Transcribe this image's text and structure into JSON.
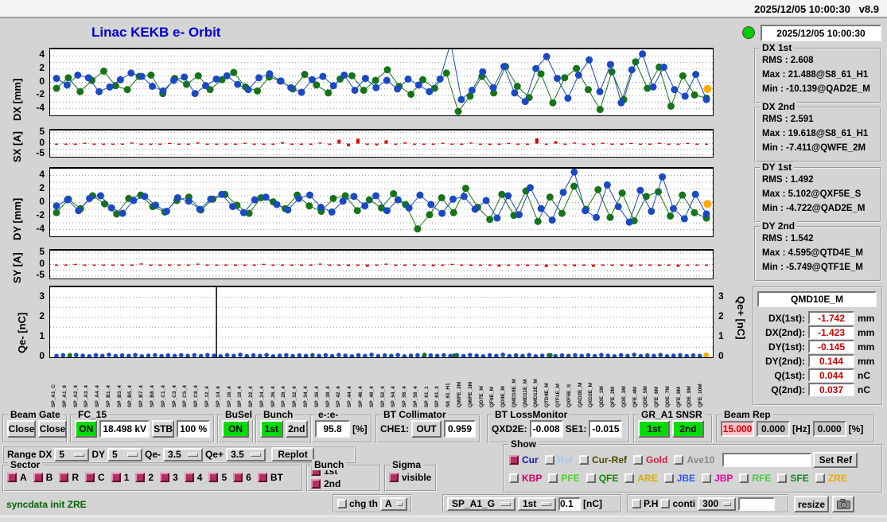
{
  "menubar": {
    "clock": "2025/12/05 10:00:30",
    "version": "v8.9"
  },
  "header": {
    "title": "Linac KEKB e- Orbit",
    "status_time": "2025/12/05 10:00:30"
  },
  "stats": [
    {
      "title": "DX 1st",
      "lines": [
        "RMS :  2.608",
        "Max :  21.488@S8_61_H1",
        "Min :  -10.139@QAD2E_M"
      ]
    },
    {
      "title": "DX 2nd",
      "lines": [
        "RMS :  2.591",
        "Max :  19.618@S8_61_H1",
        "Min :  -7.411@QWFE_2M"
      ]
    },
    {
      "title": "DY 1st",
      "lines": [
        "RMS :  1.492",
        "Max :  5.102@QXF5E_S",
        "Min :  -4.722@QAD2E_M"
      ]
    },
    {
      "title": "DY 2nd",
      "lines": [
        "RMS :  1.542",
        "Max :  4.595@QTD4E_M",
        "Min :  -5.749@QTF1E_M"
      ]
    }
  ],
  "monitor": {
    "name": "QMD10E_M",
    "rows": [
      {
        "label": "DX(1st):",
        "value": "-1.742",
        "unit": "mm"
      },
      {
        "label": "DX(2nd):",
        "value": "-1.423",
        "unit": "mm"
      },
      {
        "label": "DY(1st):",
        "value": "-0.145",
        "unit": "mm"
      },
      {
        "label": "DY(2nd):",
        "value": "0.144",
        "unit": "mm"
      },
      {
        "label": "Q(1st):",
        "value": "0.044",
        "unit": "nC"
      },
      {
        "label": "Q(2nd):",
        "value": "0.037",
        "unit": "nC"
      }
    ]
  },
  "axes": {
    "dx": "DX [mm]",
    "sx": "SX [A]",
    "dy": "DY [mm]",
    "sy": "SY [A]",
    "qem": "Qe- [nC]",
    "qep": "Qe+ [nC]"
  },
  "controls": {
    "beam_gate": {
      "legend": "Beam Gate",
      "btn1": "Close",
      "btn2": "Close"
    },
    "fc15": {
      "legend": "FC_15",
      "on": "ON",
      "kv": "18.498 kV",
      "stb": "STB",
      "pct": "100 %"
    },
    "busel": {
      "legend": "BuSel",
      "on": "ON"
    },
    "bunch": {
      "legend": "Bunch",
      "b1": "1st",
      "b2": "2nd"
    },
    "ee": {
      "legend": "e-:e-",
      "value": "95.8",
      "unit": "[%]"
    },
    "bt_coll": {
      "legend": "BT Collimator",
      "che1": "CHE1:",
      "out": "OUT",
      "value": "0.959"
    },
    "bt_loss": {
      "legend": "BT LossMonitor",
      "qxd2e_label": "QXD2E:",
      "qxd2e": "-0.008",
      "se1_label": "SE1:",
      "se1": "-0.015"
    },
    "gr_snsr": {
      "legend": "GR_A1 SNSR",
      "b1": "1st",
      "b2": "2nd"
    },
    "beam_rep": {
      "legend": "Beam Rep",
      "v1": "15.000",
      "v2": "0.000",
      "hz": "[Hz]",
      "v3": "0.000",
      "pct": "[%]"
    },
    "range": {
      "label": "Range",
      "dx_label": "DX",
      "dx": "5",
      "dy_label": "DY",
      "dy": "5",
      "qem_label": "Qe-",
      "qem": "3.5",
      "qep_label": "Qe+",
      "qep": "3.5",
      "replot": "Replot"
    },
    "sector": {
      "legend": "Sector",
      "items": [
        "A",
        "B",
        "R",
        "C",
        "1",
        "2",
        "3",
        "4",
        "5",
        "6",
        "BT"
      ]
    },
    "bunch2": {
      "legend": "Bunch",
      "items": [
        "1st",
        "2nd"
      ]
    },
    "sigma": {
      "legend": "Sigma",
      "items": [
        "visible"
      ]
    },
    "show": {
      "legend": "Show",
      "row1": [
        {
          "label": "Cur",
          "color": "#1111cc",
          "checked": true
        },
        {
          "label": "Ref",
          "color": "#a8c8f0",
          "checked": false
        },
        {
          "label": "Cur-Ref",
          "color": "#4a4a00",
          "checked": false
        },
        {
          "label": "Gold",
          "color": "#cc2244",
          "checked": false
        },
        {
          "label": "Ave10",
          "color": "#888888",
          "checked": false
        }
      ],
      "ref_input": "",
      "set_ref": "Set Ref",
      "row2": [
        {
          "label": "KBP",
          "color": "#cc0066",
          "checked": false
        },
        {
          "label": "PFE",
          "color": "#55cc33",
          "checked": false
        },
        {
          "label": "QFE",
          "color": "#118800",
          "checked": false
        },
        {
          "label": "ARE",
          "color": "#ddaa00",
          "checked": false
        },
        {
          "label": "JBE",
          "color": "#3355ee",
          "checked": false
        },
        {
          "label": "JBP",
          "color": "#ee0099",
          "checked": false
        },
        {
          "label": "RFE",
          "color": "#44cc44",
          "checked": false
        },
        {
          "label": "SFE",
          "color": "#118822",
          "checked": false
        },
        {
          "label": "ZRE",
          "color": "#eeaa00",
          "checked": false
        }
      ]
    },
    "statusbar": {
      "message": "syncdata init ZRE",
      "chg_th": "chg th",
      "th_sel": "A",
      "sp_sel": "SP_A1_G",
      "bunch_sel": "1st",
      "th_val": "0.1",
      "th_unit": "[nC]",
      "ph": "P.H",
      "conti": "conti",
      "interval": "300",
      "blank": "",
      "resize": "resize"
    }
  },
  "colors": {
    "series_blue": "#1b49c4",
    "series_green": "#177317",
    "series_red": "#dd0000",
    "series_orange": "#ffaa00",
    "on_green": "#00dd00",
    "check_maroon": "#b03060"
  },
  "xlabels": [
    "SP_A1_C",
    "SP_A1_9",
    "SP_A2_4",
    "SP_A3_4",
    "SP_A4_4",
    "SP_B1_4",
    "SP_B3_4",
    "SP_B5_4",
    "SP_B7_4",
    "SP_B8_4",
    "SP_C1_4",
    "SP_C3_4",
    "SP_C5_4",
    "SP_C8_4",
    "SP_12_4",
    "SP_14_4",
    "SP_16_4",
    "SP_18_4",
    "SP_22_4",
    "SP_24_4",
    "SP_26_4",
    "SP_28_4",
    "SP_32_4",
    "SP_34_4",
    "SP_36_4",
    "SP_38_4",
    "SP_42_4",
    "SP_44_4",
    "SP_46_4",
    "SP_48_4",
    "SP_52_4",
    "SP_54_4",
    "SP_56_4",
    "SP_58_4",
    "SP_61_1",
    "SP_61_3",
    "S8_61_H1",
    "QWFE_2M",
    "QWFE_3M",
    "QD7E_M",
    "QF8E_M",
    "QD9E_M",
    "QMD10E_M",
    "QMD11E_M",
    "QMD12E_M",
    "QTD4E_M",
    "QTF1E_M",
    "QXF5E_S",
    "QAD2E_M",
    "QXD2E_M",
    "QDE_1M",
    "QFE_2M",
    "QDE_3M",
    "QFE_4M",
    "QDE_5M",
    "QFE_6M",
    "QDE_7M",
    "QFE_8M",
    "QDE_9M",
    "QFE_10M"
  ],
  "chart_data": [
    {
      "id": "dx",
      "type": "scatter",
      "ylabel": "DX [mm]",
      "ylim": [
        -5,
        5
      ],
      "grid": [
        -4,
        -3,
        -2,
        -1,
        0,
        1,
        2,
        3,
        4
      ],
      "yticks": [
        {
          "v": 4,
          "t": "4"
        },
        {
          "v": 2,
          "t": "2"
        },
        {
          "v": 0,
          "t": "0"
        },
        {
          "v": -2,
          "t": "-2"
        },
        {
          "v": -4,
          "t": "-4"
        }
      ],
      "series": [
        {
          "name": "2nd",
          "type": "line-dots",
          "color": "#177317",
          "r": 4.5,
          "values": [
            -0.9,
            0.7,
            -1.4,
            0.3,
            1.7,
            -0.5,
            -1.1,
            0.9,
            1.1,
            -1.7,
            0.6,
            -0.3,
            1.0,
            -1.1,
            0.4,
            1.5,
            -0.7,
            -1.3,
            0.8,
            0.2,
            -1.0,
            1.2,
            -0.4,
            -1.6,
            0.5,
            1.0,
            -1.2,
            0.3,
            1.9,
            -0.6,
            -1.8,
            0.4,
            -0.9,
            1.4,
            -4.4,
            -2.1,
            0.9,
            -1.6,
            2.4,
            -0.6,
            -2.3,
            1.3,
            -3.1,
            0.7,
            2.1,
            -1.1,
            -4.1,
            1.6,
            -2.6,
            3.1,
            -0.9,
            2.3,
            -3.6,
            1.0,
            -1.9,
            -2.4
          ]
        },
        {
          "name": "1st",
          "type": "line-dots",
          "color": "#1b49c4",
          "r": 4.5,
          "values": [
            0.6,
            -0.4,
            1.1,
            0.7,
            -1.4,
            -0.7,
            0.4,
            1.4,
            0.9,
            -0.6,
            -1.3,
            0.3,
            0.8,
            -1.7,
            -0.5,
            0.5,
            1.0,
            -0.3,
            -1.1,
            0.7,
            1.3,
            0.2,
            -0.8,
            -1.5,
            0.4,
            0.9,
            -0.5,
            1.1,
            -1.2,
            0.6,
            -0.8,
            0.3,
            -1.0,
            0.5,
            -0.4,
            -1.4,
            0.5,
            6.0,
            -2.6,
            -1.2,
            1.6,
            -0.8,
            2.4,
            -1.6,
            -2.9,
            2.1,
            3.9,
            0.6,
            -2.4,
            1.1,
            3.4,
            -1.4,
            2.7,
            -3.1,
            1.9,
            4.3,
            -0.7,
            2.3,
            -1.1,
            -2.1,
            1.2,
            -2.6
          ]
        },
        {
          "name": "marker",
          "type": "dots",
          "color": "#ffaa00",
          "r": 5,
          "points": [
            [
              0.992,
              -1.0
            ]
          ]
        }
      ]
    },
    {
      "id": "sx",
      "type": "bar",
      "ylabel": "SX [A]",
      "ylim": [
        -6,
        6
      ],
      "grid": [
        -5,
        -2.5,
        0,
        2.5,
        5
      ],
      "yticks": [
        {
          "v": 5,
          "t": "5"
        },
        {
          "v": 0,
          "t": "0"
        },
        {
          "v": -5,
          "t": "-5"
        }
      ],
      "series": [
        {
          "name": "SX",
          "type": "bars",
          "color": "#dd0000",
          "values": [
            0,
            0,
            0,
            0.4,
            0,
            -0.3,
            0,
            0,
            0.5,
            0,
            0,
            -0.4,
            0.3,
            0,
            0,
            0.6,
            0,
            0,
            -0.5,
            0,
            0.4,
            0,
            0,
            0,
            0.7,
            0,
            -0.4,
            0,
            0.5,
            0,
            1.8,
            -1.2,
            2.2,
            0,
            -0.8,
            1.5,
            0,
            0.6,
            0,
            -0.5,
            0,
            0.4,
            0,
            0,
            0.5,
            0,
            -0.6,
            0,
            0.3,
            0,
            0,
            2.4,
            0,
            1.1,
            0,
            0.5,
            0,
            0,
            0.4,
            0,
            0,
            0.3,
            0,
            0,
            0.4,
            0,
            0,
            0.3,
            0,
            0
          ]
        }
      ]
    },
    {
      "id": "dy",
      "type": "scatter",
      "ylabel": "DY [mm]",
      "ylim": [
        -5,
        5
      ],
      "grid": [
        -4,
        -3,
        -2,
        -1,
        0,
        1,
        2,
        3,
        4
      ],
      "yticks": [
        {
          "v": 4,
          "t": "4"
        },
        {
          "v": 2,
          "t": "2"
        },
        {
          "v": 0,
          "t": "0"
        },
        {
          "v": -2,
          "t": "-2"
        },
        {
          "v": -4,
          "t": "-4"
        }
      ],
      "series": [
        {
          "name": "2nd",
          "type": "line-dots",
          "color": "#177317",
          "r": 4.5,
          "values": [
            -1.5,
            0.5,
            -0.9,
            1.0,
            -0.2,
            -1.7,
            0.6,
            1.1,
            -0.6,
            -1.4,
            0.3,
            0.8,
            -1.1,
            0.5,
            1.2,
            -0.4,
            -1.6,
            0.7,
            0.1,
            -0.9,
            1.1,
            -0.5,
            -1.3,
            0.6,
            1.0,
            -1.2,
            0.4,
            -0.8,
            1.3,
            -0.3,
            -3.9,
            -1.8,
            0.7,
            -1.5,
            2.1,
            -0.7,
            -2.5,
            1.2,
            -1.9,
            1.7,
            -2.8,
            0.8,
            -1.6,
            2.4,
            -1.0,
            1.9,
            -2.2,
            1.4,
            -2.7,
            0.9,
            1.6,
            -2.0,
            1.1,
            -1.5,
            -2.3
          ]
        },
        {
          "name": "1st",
          "type": "line-dots",
          "color": "#1b49c4",
          "r": 4.5,
          "values": [
            -0.5,
            0.4,
            -1.2,
            0.6,
            1.0,
            -0.8,
            -1.6,
            0.3,
            0.9,
            -0.4,
            -1.3,
            0.7,
            0.2,
            -1.0,
            0.5,
            1.2,
            -0.6,
            -1.5,
            0.4,
            0.8,
            -0.3,
            -1.1,
            0.6,
            1.1,
            -0.7,
            -1.4,
            0.2,
            0.9,
            -0.5,
            1.0,
            -1.2,
            0.4,
            -0.8,
            1.1,
            -0.3,
            -1.6,
            0.5,
            0.9,
            -1.0,
            0.3,
            -2.3,
            1.0,
            -1.8,
            2.2,
            -0.9,
            -2.6,
            1.5,
            4.5,
            -1.2,
            -2.2,
            2.6,
            -0.6,
            -2.9,
            1.8,
            -1.3,
            3.8,
            -0.9,
            -2.4,
            1.2,
            -1.7
          ]
        },
        {
          "name": "marker",
          "type": "dots",
          "color": "#ffaa00",
          "r": 5,
          "points": [
            [
              0.992,
              -0.2
            ]
          ]
        }
      ]
    },
    {
      "id": "sy",
      "type": "bar",
      "ylabel": "SY [A]",
      "ylim": [
        -6,
        6
      ],
      "grid": [
        -5,
        -2.5,
        0,
        2.5,
        5
      ],
      "yticks": [
        {
          "v": 5,
          "t": "5"
        },
        {
          "v": 0,
          "t": "0"
        },
        {
          "v": -5,
          "t": "-5"
        }
      ],
      "series": [
        {
          "name": "SY",
          "type": "bars",
          "color": "#dd0000",
          "values": [
            0,
            0,
            0.3,
            0,
            0,
            -0.4,
            0,
            0,
            0,
            0.5,
            0,
            0,
            -0.3,
            0,
            0,
            0.4,
            0,
            0,
            0,
            -0.5,
            0,
            0,
            0.3,
            0,
            0,
            -0.4,
            0,
            0,
            0.4,
            0,
            0,
            -0.6,
            0,
            -0.9,
            0,
            0.4,
            0,
            -0.5,
            0,
            0,
            -0.7,
            0,
            0.3,
            0,
            -0.5,
            0,
            0,
            -0.8,
            0,
            0,
            -0.6,
            0,
            -1.0,
            0,
            0,
            -0.7,
            0,
            -0.9,
            0,
            -0.5,
            0,
            -0.8,
            0,
            0,
            -0.6,
            0,
            -0.9,
            -0.4,
            0,
            0
          ]
        }
      ]
    },
    {
      "id": "qe",
      "type": "scatter",
      "ylabel": "Qe- [nC]",
      "ylabel_right": "Qe+ [nC]",
      "ylim": [
        0,
        3.5
      ],
      "grid": [
        0.5,
        1,
        1.5,
        2,
        2.5,
        3
      ],
      "yticks": [
        {
          "v": 3,
          "t": "3"
        },
        {
          "v": 2,
          "t": "2"
        },
        {
          "v": 1,
          "t": "1"
        },
        {
          "v": 0,
          "t": "0"
        }
      ],
      "yticks_right": [
        {
          "v": 3,
          "t": "3"
        },
        {
          "v": 2,
          "t": "2"
        },
        {
          "v": 1,
          "t": "1"
        },
        {
          "v": 0,
          "t": "0"
        }
      ],
      "series": [
        {
          "name": "spike",
          "type": "vline",
          "color": "#000000",
          "x": 0.251
        },
        {
          "name": "Qe-",
          "type": "dots-even",
          "color": "#1b49c4",
          "r": 2.8,
          "values": [
            0.07,
            0.1,
            0.06,
            0.11,
            0.08,
            0.05,
            0.1,
            0.07,
            0.12,
            0.06,
            0.09,
            0.07,
            0.11,
            0.05,
            0.08,
            0.1,
            0.06,
            0.09,
            0.07,
            0.1,
            0.07,
            0.1,
            0.06,
            0.11,
            0.08,
            0.05,
            0.1,
            0.07,
            0.12,
            0.06,
            0.09,
            0.07,
            0.11,
            0.05,
            0.08,
            0.1,
            0.06,
            0.09,
            0.07,
            0.1,
            0.07,
            0.1,
            0.06,
            0.11,
            0.08,
            0.05,
            0.1,
            0.07,
            0.12,
            0.06,
            0.09,
            0.07,
            0.11,
            0.05,
            0.08,
            0.1,
            0.06,
            0.09,
            0.07,
            0.1,
            0.07,
            0.1,
            0.06,
            0.11,
            0.08,
            0.05,
            0.1,
            0.07,
            0.12,
            0.06,
            0.09,
            0.07,
            0.11,
            0.05,
            0.08,
            0.1,
            0.06,
            0.09,
            0.07,
            0.1,
            0.07,
            0.1,
            0.06,
            0.11,
            0.08,
            0.05,
            0.1,
            0.07,
            0.12,
            0.06,
            0.09,
            0.07,
            0.11,
            0.05,
            0.08,
            0.1,
            0.06,
            0.09,
            0.07,
            0.1
          ]
        },
        {
          "name": "Qe2",
          "type": "dots",
          "color": "#177317",
          "r": 2.8,
          "points": [
            [
              0.03,
              0.1
            ],
            [
              0.565,
              0.12
            ],
            [
              0.61,
              0.09
            ],
            [
              0.755,
              0.1
            ]
          ]
        },
        {
          "name": "marker",
          "type": "dots",
          "color": "#ffaa00",
          "r": 3.5,
          "points": [
            [
              0.99,
              0.1
            ]
          ]
        }
      ]
    }
  ]
}
